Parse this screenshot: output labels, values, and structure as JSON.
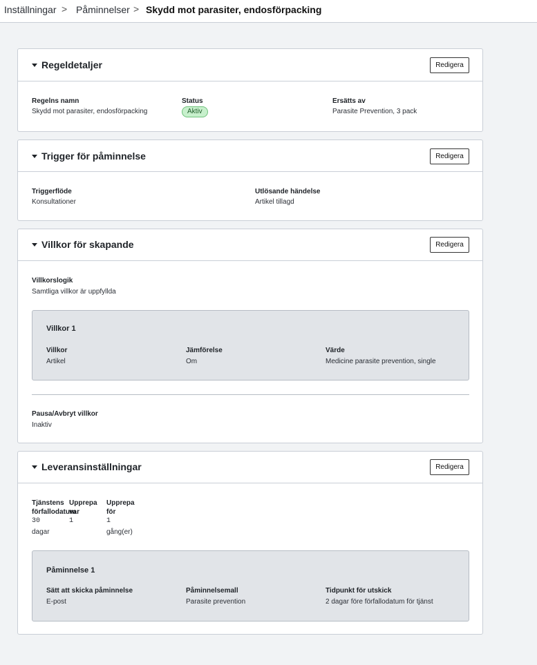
{
  "breadcrumb": {
    "items": [
      "Inställningar",
      "Påminnelser"
    ],
    "current": "Skydd mot parasiter, endosförpacking",
    "separator": ">"
  },
  "edit_label": "Redigera",
  "rule_details": {
    "title": "Regeldetaljer",
    "name_label": "Regelns namn",
    "name_value": "Skydd mot parasiter, endosförpacking",
    "status_label": "Status",
    "status_value": "Aktiv",
    "replaced_label": "Ersätts av",
    "replaced_value": "Parasite Prevention, 3 pack"
  },
  "trigger": {
    "title": "Trigger för påminnelse",
    "flow_label": "Triggerflöde",
    "flow_value": "Konsultationer",
    "event_label": "Utlösande händelse",
    "event_value": "Artikel tillagd"
  },
  "conditions": {
    "title": "Villkor för skapande",
    "logic_label": "Villkorslogik",
    "logic_value": "Samtliga villkor är uppfyllda",
    "condition_title": "Villkor 1",
    "col1_label": "Villkor",
    "col1_value": "Artikel",
    "col2_label": "Jämförelse",
    "col2_value": "Om",
    "col3_label": "Värde",
    "col3_value": "Medicine parasite prevention, single",
    "pause_label": "Pausa/Avbryt villkor",
    "pause_value": "Inaktiv"
  },
  "delivery": {
    "title": "Leveransinställningar",
    "due_label": "Tjänstens förfallodatum",
    "due_value": "30",
    "due_unit": "dagar",
    "repeat_every_label": "Upprepa var",
    "repeat_every_value": "1",
    "repeat_for_label": "Upprepa för",
    "repeat_for_value": "1",
    "repeat_for_unit": "gång(er)",
    "reminder_title": "Påminnelse 1",
    "method_label": "Sätt att skicka påminnelse",
    "method_value": "E-post",
    "template_label": "Påminnelsemall",
    "template_value": "Parasite prevention",
    "timing_label": "Tidpunkt för utskick",
    "timing_value": "2 dagar före förfallodatum för tjänst"
  }
}
